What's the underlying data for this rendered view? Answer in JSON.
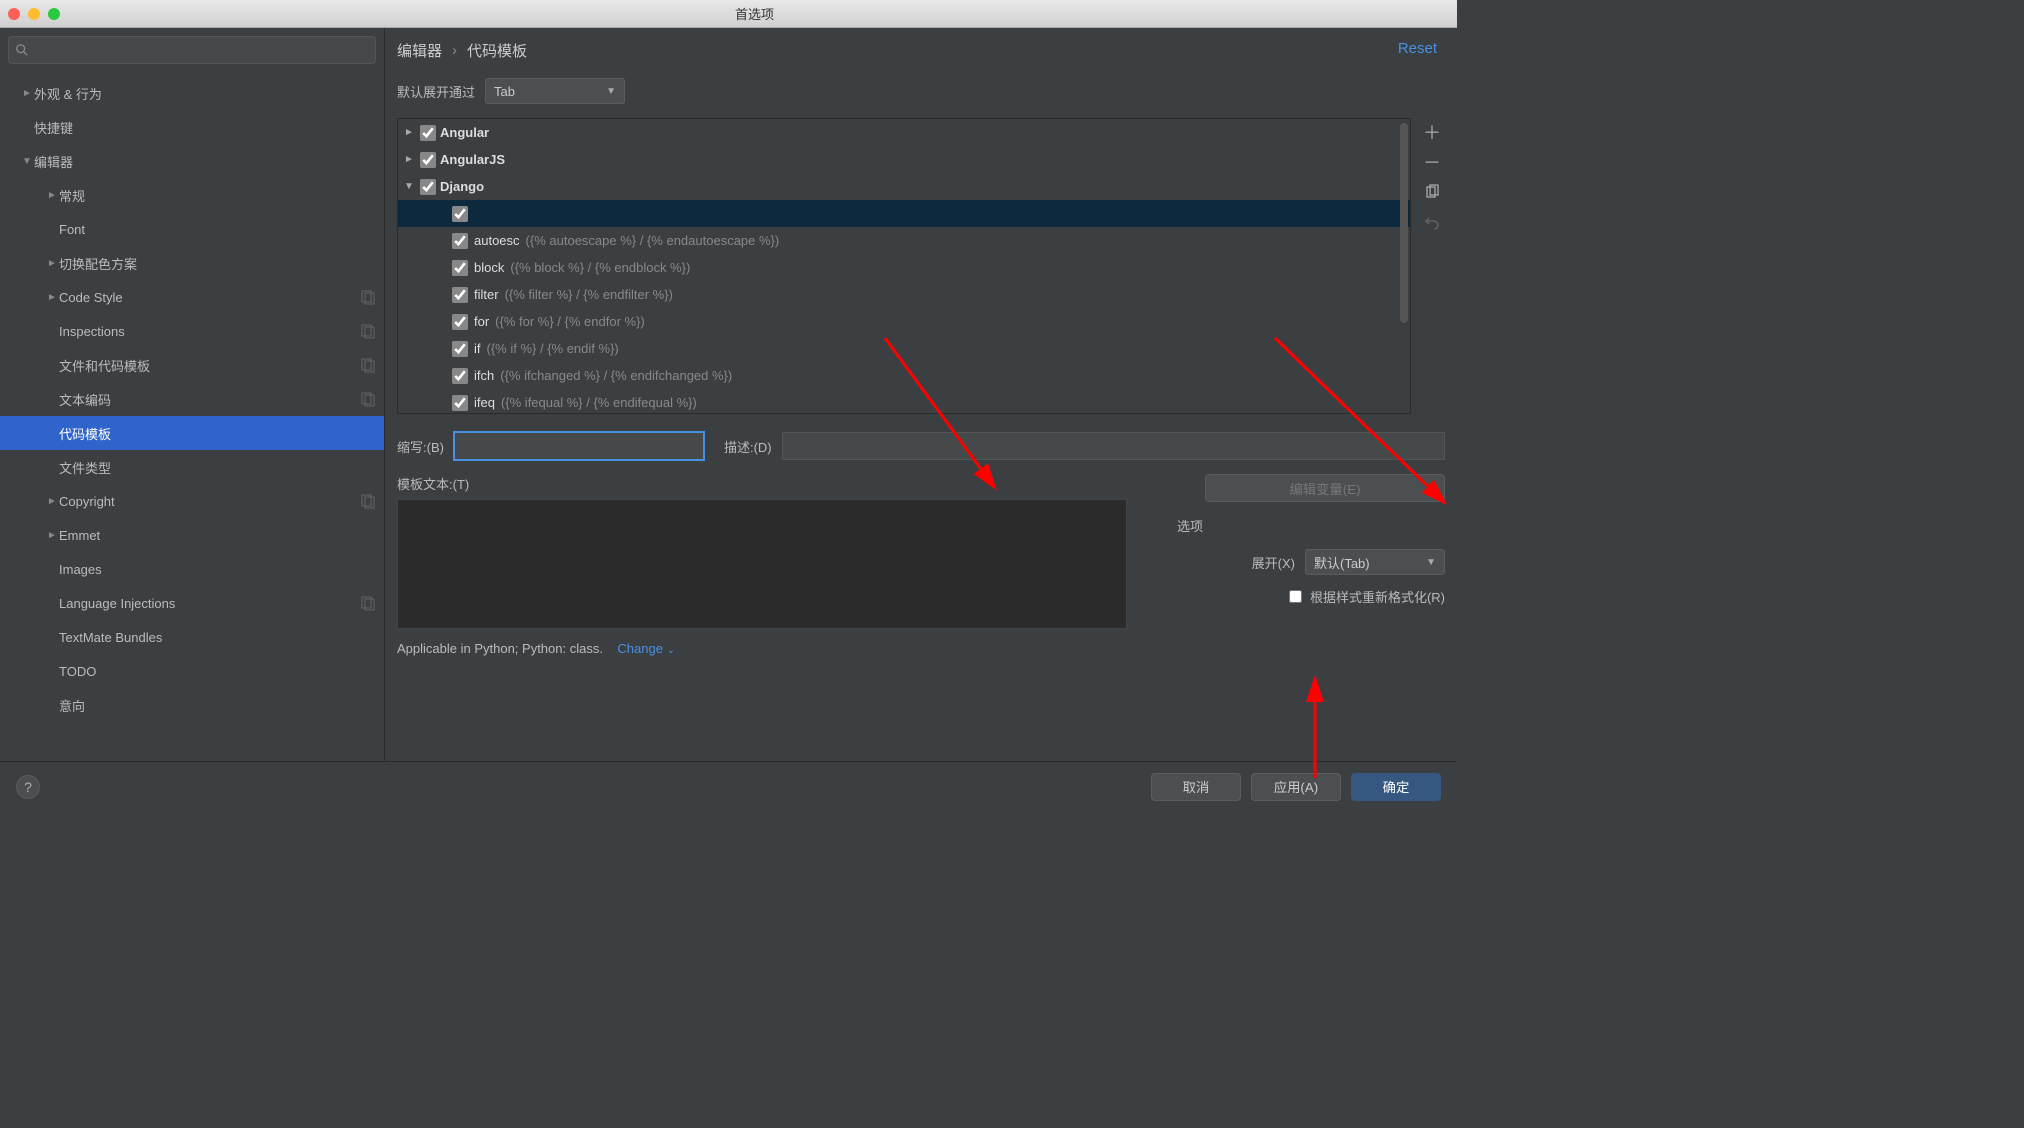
{
  "window": {
    "title": "首选项"
  },
  "breadcrumb": {
    "editor": "编辑器",
    "sub": "代码模板"
  },
  "reset": "Reset",
  "expand_label": "默认展开通过",
  "expand_value": "Tab",
  "sidebar": {
    "items": [
      {
        "label": "外观 & 行为",
        "arrow": "►",
        "lvl": 1
      },
      {
        "label": "快捷键",
        "arrow": "",
        "lvl": 1
      },
      {
        "label": "编辑器",
        "arrow": "▼",
        "lvl": 1
      },
      {
        "label": "常规",
        "arrow": "►",
        "lvl": 2
      },
      {
        "label": "Font",
        "arrow": "",
        "lvl": 2
      },
      {
        "label": "切换配色方案",
        "arrow": "►",
        "lvl": 2
      },
      {
        "label": "Code Style",
        "arrow": "►",
        "lvl": 2,
        "badge": true
      },
      {
        "label": "Inspections",
        "arrow": "",
        "lvl": 2,
        "badge": true
      },
      {
        "label": "文件和代码模板",
        "arrow": "",
        "lvl": 2,
        "badge": true
      },
      {
        "label": "文本编码",
        "arrow": "",
        "lvl": 2,
        "badge": true
      },
      {
        "label": "代码模板",
        "arrow": "",
        "lvl": 2,
        "sel": true
      },
      {
        "label": "文件类型",
        "arrow": "",
        "lvl": 2
      },
      {
        "label": "Copyright",
        "arrow": "►",
        "lvl": 2,
        "badge": true
      },
      {
        "label": "Emmet",
        "arrow": "►",
        "lvl": 2
      },
      {
        "label": "Images",
        "arrow": "",
        "lvl": 2
      },
      {
        "label": "Language Injections",
        "arrow": "",
        "lvl": 2,
        "badge": true
      },
      {
        "label": "TextMate Bundles",
        "arrow": "",
        "lvl": 2
      },
      {
        "label": "TODO",
        "arrow": "",
        "lvl": 2
      },
      {
        "label": "意向",
        "arrow": "",
        "lvl": 2
      }
    ]
  },
  "templates": {
    "groups": [
      {
        "name": "Angular",
        "expanded": false
      },
      {
        "name": "AngularJS",
        "expanded": false
      }
    ],
    "django": {
      "name": "Django"
    },
    "items": [
      {
        "abbr": "autoesc",
        "desc": "({% autoescape %} / {% endautoescape %})"
      },
      {
        "abbr": "block",
        "desc": "({% block %} / {% endblock %})"
      },
      {
        "abbr": "filter",
        "desc": "({% filter %} / {% endfilter %})"
      },
      {
        "abbr": "for",
        "desc": "({% for %} / {% endfor %})"
      },
      {
        "abbr": "if",
        "desc": "({% if %} / {% endif %})"
      },
      {
        "abbr": "ifch",
        "desc": "({% ifchanged %} / {% endifchanged %})"
      },
      {
        "abbr": "ifeq",
        "desc": "({% ifequal %} / {% endifequal %})"
      }
    ]
  },
  "fields": {
    "abbr_label": "缩写:(B)",
    "desc_label": "描述:(D)",
    "text_label": "模板文本:(T)",
    "edit_vars": "编辑变量(E)"
  },
  "options": {
    "header": "选项",
    "expand_label": "展开(X)",
    "expand_value": "默认(Tab)",
    "reformat": "根据样式重新格式化(R)"
  },
  "applicable": {
    "text": "Applicable in Python; Python: class.",
    "change": "Change"
  },
  "footer": {
    "cancel": "取消",
    "apply": "应用(A)",
    "ok": "确定"
  }
}
